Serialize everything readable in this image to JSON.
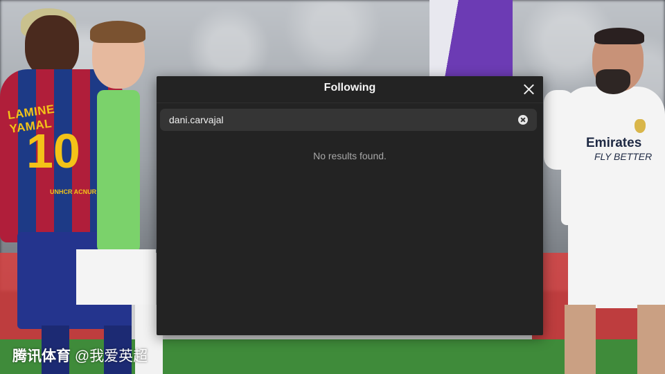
{
  "background": {
    "barca_jersey_name": "LAMINE YAMAL",
    "barca_jersey_number": "10",
    "barca_jersey_sponsor": "UNHCR ACNUR",
    "real_jersey_sponsor": "Emirates",
    "real_jersey_tagline": "FLY BETTER"
  },
  "dialog": {
    "title": "Following",
    "search_value": "dani.carvajal",
    "empty_message": "No results found.",
    "close_icon": "close-icon",
    "clear_icon": "clear-search-icon"
  },
  "watermark": {
    "logo_text": "腾讯体育",
    "handle": "@我爱英超"
  },
  "colors": {
    "dialog_bg": "#232323",
    "search_bg": "#353535",
    "title_text": "#f5f5f5",
    "muted_text": "#a8a8a8"
  }
}
